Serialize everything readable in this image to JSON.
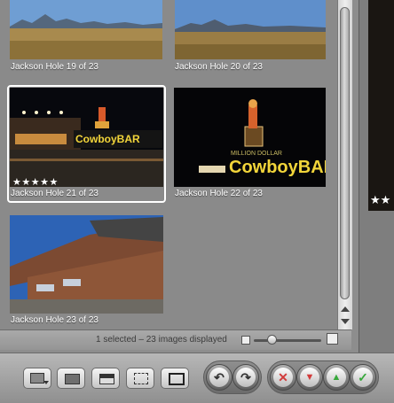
{
  "browser": {
    "thumbnails": [
      {
        "caption": "Jackson Hole 19 of 23",
        "selected": false,
        "rating": ""
      },
      {
        "caption": "Jackson Hole 20 of 23",
        "selected": false,
        "rating": ""
      },
      {
        "caption": "Jackson Hole 21 of 23",
        "selected": true,
        "rating": "★★★★★"
      },
      {
        "caption": "Jackson Hole 22 of 23",
        "selected": false,
        "rating": ""
      },
      {
        "caption": "Jackson Hole 23 of 23",
        "selected": false,
        "rating": ""
      }
    ],
    "sign_text": "CowboyBAR"
  },
  "right_pane": {
    "rating": "★★"
  },
  "status": {
    "text": "1 selected – 23 images displayed"
  },
  "toolbar": {
    "buttons": [
      {
        "name": "monitor-icon"
      },
      {
        "name": "filmstrip-icon"
      },
      {
        "name": "viewer-split-icon"
      },
      {
        "name": "fullscreen-frame-icon"
      },
      {
        "name": "single-view-icon"
      }
    ],
    "actions": [
      {
        "name": "rotate-left-icon",
        "glyph": "↶"
      },
      {
        "name": "rotate-right-icon",
        "glyph": "↷"
      },
      {
        "name": "reject-icon",
        "glyph": "✕",
        "color": "#d23b3b"
      },
      {
        "name": "decrease-rating-icon",
        "glyph": "▼",
        "color": "#d23b3b"
      },
      {
        "name": "increase-rating-icon",
        "glyph": "▲",
        "color": "#36a83a"
      },
      {
        "name": "approve-icon",
        "glyph": "✓",
        "color": "#36a83a"
      }
    ]
  },
  "colors": {
    "selection": "#ffffff",
    "neon": "#f2d53a",
    "sky": "#2d63b5"
  }
}
